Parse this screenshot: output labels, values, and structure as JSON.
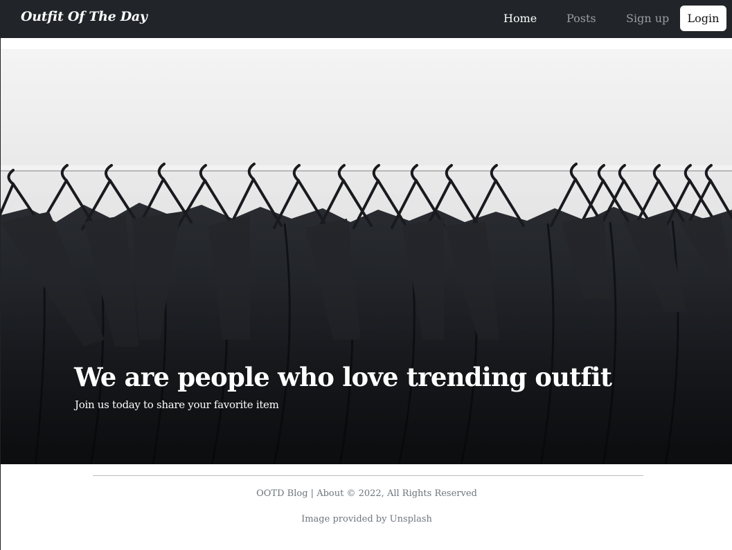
{
  "navbar": {
    "brand": "Outfit Of The Day",
    "links": [
      {
        "label": "Home",
        "active": true
      },
      {
        "label": "Posts",
        "active": false
      },
      {
        "label": "Sign up",
        "active": false
      }
    ],
    "login_label": "Login"
  },
  "hero": {
    "title": "We are people who love trending outfit",
    "subtitle": "Join us today to share your favorite item"
  },
  "footer": {
    "blog_link": "OOTD Blog",
    "separator": "|",
    "about_link": "About",
    "copyright": "© 2022, All Rights Reserved",
    "credit_prefix": "Image provided by",
    "credit_link": "Unsplash"
  },
  "colors": {
    "navbar_bg": "#212529",
    "nav_active": "#ffffff",
    "nav_inactive": "#8f9194",
    "footer_text": "#6c757d"
  },
  "icons": [
    "clothes-rack-photo"
  ]
}
